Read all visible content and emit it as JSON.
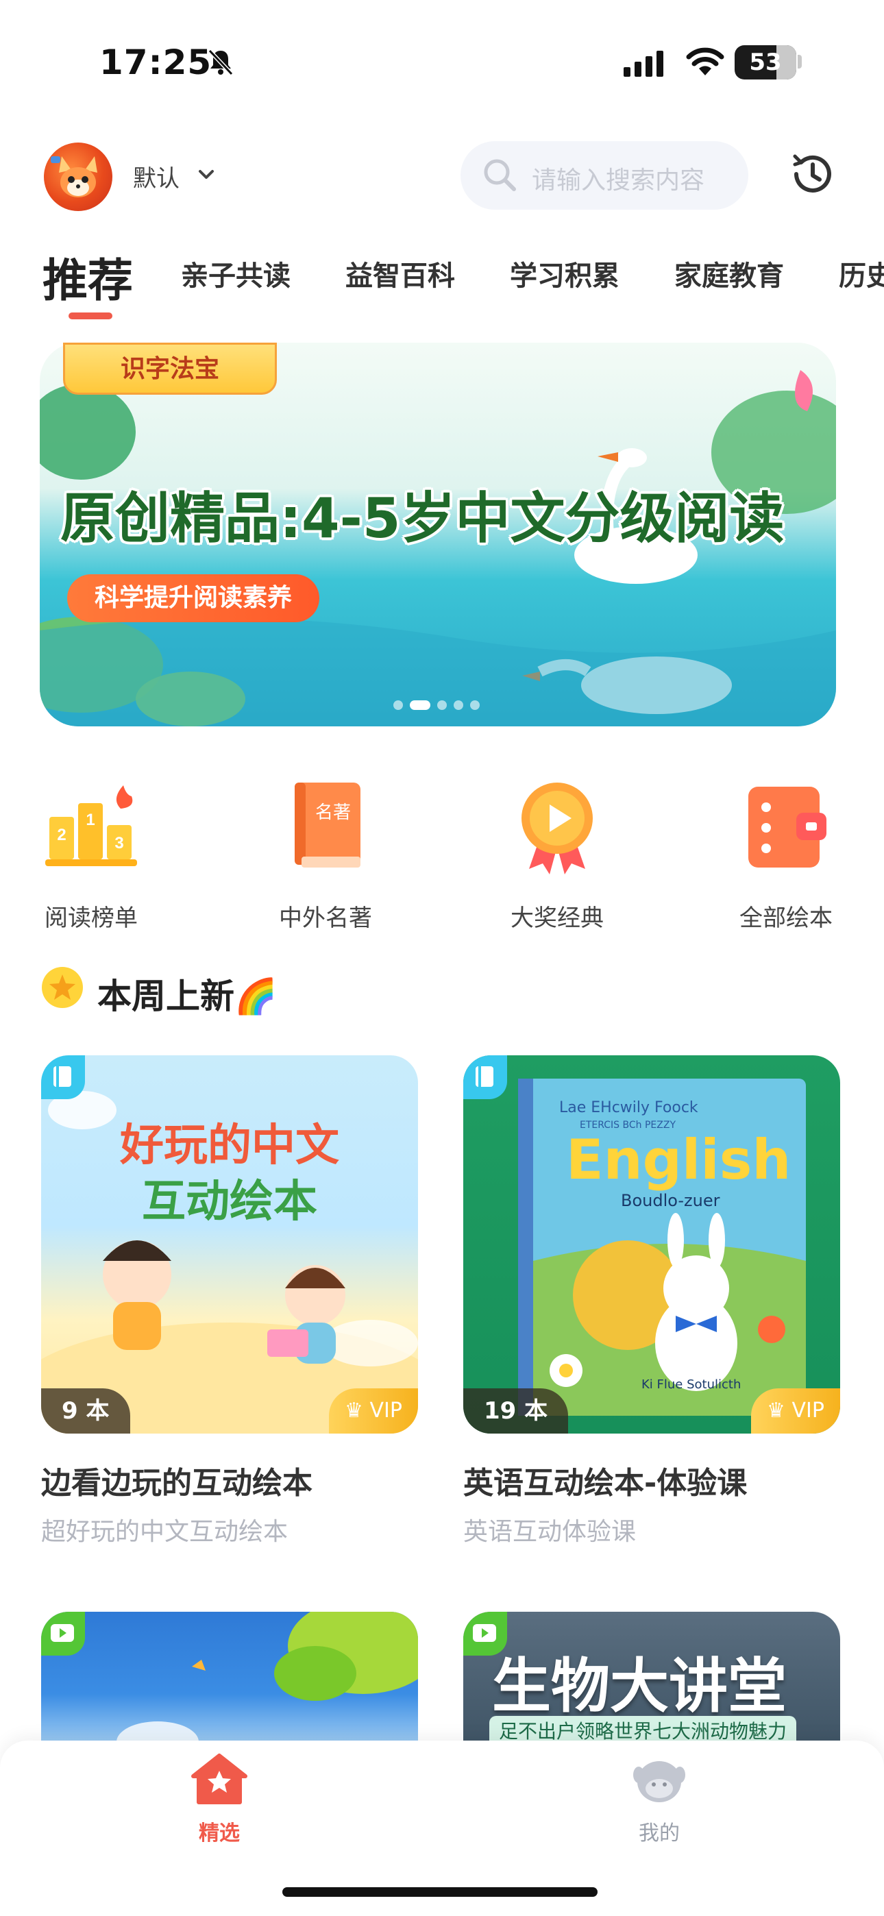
{
  "status_bar": {
    "time": "17:25",
    "battery": "53",
    "battery_level": 0.53
  },
  "header": {
    "profile_name": "默认",
    "search_placeholder": "请输入搜索内容"
  },
  "tabs": [
    "推荐",
    "亲子共读",
    "益智百科",
    "学习积累",
    "家庭教育",
    "历史"
  ],
  "banner": {
    "badge": "识字法宝",
    "title": "原创精品:4-5岁中文分级阅读",
    "subtitle": "科学提升阅读素养",
    "page_count": 5,
    "active_index": 1
  },
  "categories": [
    {
      "label": "阅读榜单",
      "icon": "podium-icon"
    },
    {
      "label": "中外名著",
      "icon": "book-icon",
      "icon_text": "名著"
    },
    {
      "label": "大奖经典",
      "icon": "award-play-icon"
    },
    {
      "label": "全部绘本",
      "icon": "wallet-list-icon"
    }
  ],
  "section": {
    "title": "本周上新🌈"
  },
  "cards": [
    {
      "cover_line1": "好玩的中文",
      "cover_line2": "互动绘本",
      "count": "9 本",
      "vip": "VIP",
      "title": "边看边玩的互动绘本",
      "subtitle": "超好玩的中文互动绘本"
    },
    {
      "cover_top": "Lae EHcwily Foock",
      "cover_top2": "ETERCIS BCh PEZZY",
      "cover_word": "English",
      "cover_sub": "Boudlo-zuer",
      "cover_bottom": "Ki Flue Sotulicth",
      "cover_spine": "English",
      "count": "19 本",
      "vip": "VIP",
      "title": "英语互动绘本-体验课",
      "subtitle": "英语互动体验课"
    },
    {
      "type": "video"
    },
    {
      "type": "video",
      "cover_title": "生物大讲堂",
      "cover_sub": "足不出户领略世界七大洲动物魅力"
    }
  ],
  "bottom_nav": [
    {
      "label": "精选",
      "active": true
    },
    {
      "label": "我的",
      "active": false
    }
  ],
  "colors": {
    "accent": "#f05a4a",
    "vip": "#f6b21e",
    "tag_blue": "#38c8ee",
    "tag_green": "#54c636"
  }
}
